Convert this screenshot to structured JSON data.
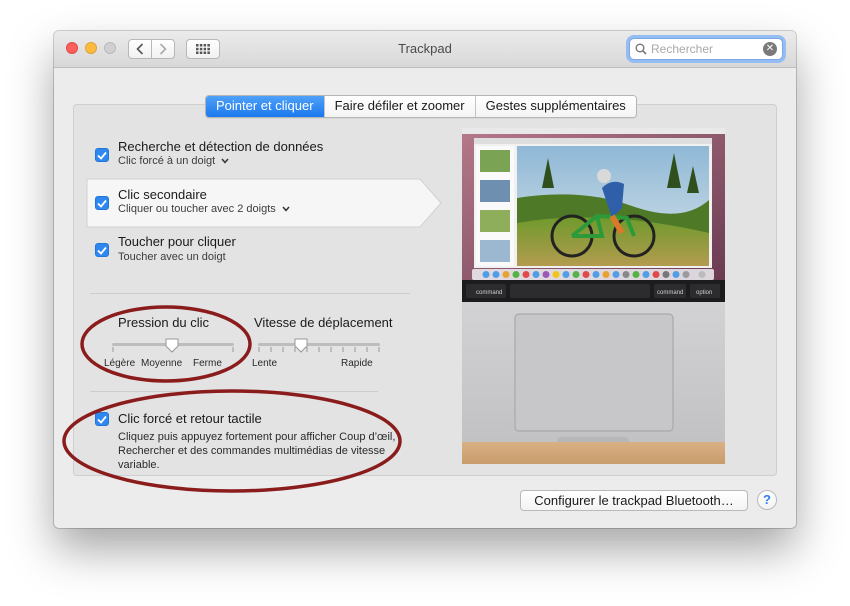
{
  "window": {
    "title": "Trackpad"
  },
  "search": {
    "placeholder": "Rechercher"
  },
  "tabs": [
    {
      "label": "Pointer et cliquer",
      "active": true
    },
    {
      "label": "Faire défiler et zoomer",
      "active": false
    },
    {
      "label": "Gestes supplémentaires",
      "active": false
    }
  ],
  "options": [
    {
      "title": "Recherche et détection de données",
      "subtitle": "Clic forcé à un doigt",
      "checked": true
    },
    {
      "title": "Clic secondaire",
      "subtitle": "Cliquer ou toucher avec 2 doigts",
      "checked": true
    },
    {
      "title": "Toucher pour cliquer",
      "subtitle": "Toucher avec un doigt",
      "checked": true
    }
  ],
  "click_pressure": {
    "label": "Pression du clic",
    "ticks": [
      "Légère",
      "Moyenne",
      "Ferme"
    ],
    "value_index": 1
  },
  "tracking_speed": {
    "label": "Vitesse de déplacement",
    "min_label": "Lente",
    "max_label": "Rapide",
    "value_fraction": 0.35
  },
  "force_click": {
    "title": "Clic forcé et retour tactile",
    "description": "Cliquez puis appuyez fortement pour afficher Coup d’œil, Rechercher et des commandes multimédias de vitesse variable.",
    "checked": true
  },
  "preview": {
    "key_left": "command",
    "key_right_1": "command",
    "key_right_2": "option"
  },
  "footer": {
    "bluetooth_button": "Configurer le trackpad Bluetooth…",
    "help_label": "?"
  },
  "colors": {
    "accent": "#2f88f0",
    "annotation": "#8b1c1c"
  }
}
